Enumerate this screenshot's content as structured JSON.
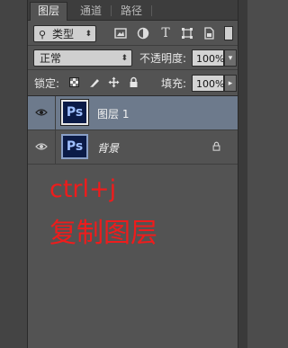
{
  "tabs": [
    "图层",
    "通道",
    "路径"
  ],
  "filter": {
    "kind_label": "类型",
    "kind_icon": "search-icon"
  },
  "blend_mode": "正常",
  "opacity_label": "不透明度:",
  "opacity_value": "100%",
  "lock_label": "锁定:",
  "fill_label": "填充:",
  "fill_value": "100%",
  "layers": [
    {
      "name": "图层 1",
      "thumb_label": "Ps",
      "selected": true
    },
    {
      "name": "背景",
      "thumb_label": "Ps",
      "locked": true
    }
  ],
  "annotation": {
    "line1": "ctrl+j",
    "line2": "复制图层",
    "color": "#ee1c1c"
  },
  "colors": {
    "selected_row": "#6d7a8c",
    "panel_bg": "#535353"
  }
}
